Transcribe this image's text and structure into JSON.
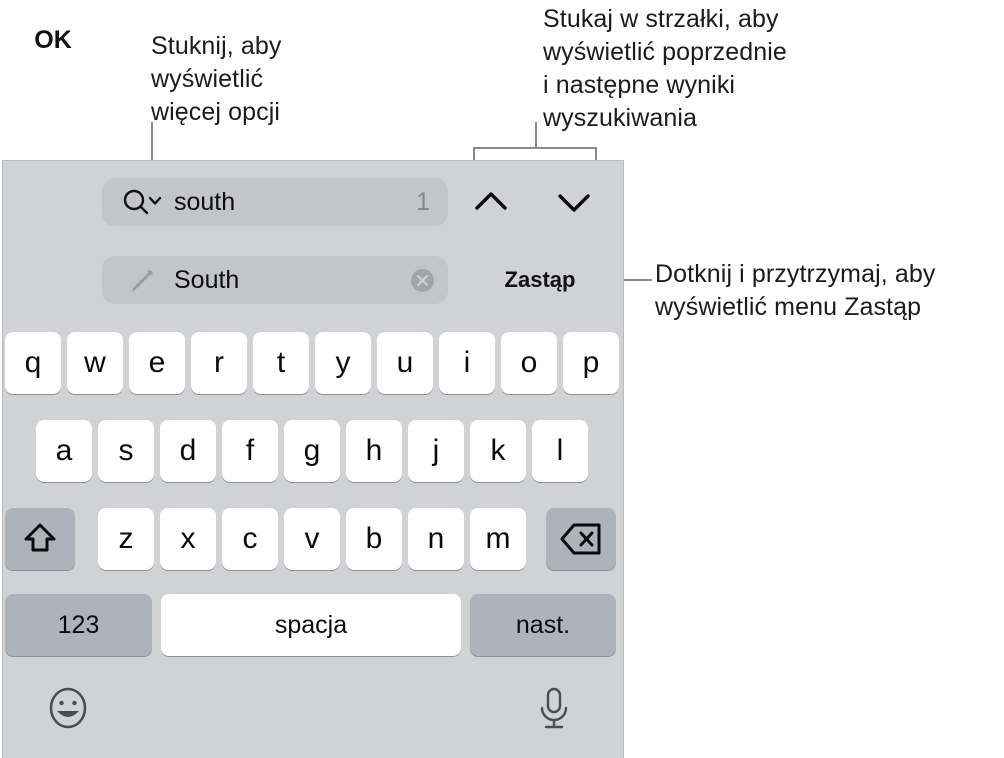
{
  "annotations": {
    "left": "Stuknij, aby\nwyświetlić\nwięcej opcji",
    "top_right": "Stukaj w strzałki, aby\nwyświetlić poprzednie\ni następne wyniki\nwyszukiwania",
    "right": "Dotknij i przytrzymaj, aby\nwyświetlić menu Zastąp"
  },
  "toolbar": {
    "ok_label": "OK",
    "search": {
      "value": "south",
      "match_count": "1",
      "icon": "search-icon",
      "disclosure_icon": "chevron-down-icon"
    },
    "replace": {
      "value": "South",
      "icon": "pencil-icon",
      "clear_icon": "clear-circle-icon"
    },
    "prev_icon": "chevron-up-icon",
    "next_icon": "chevron-down-icon",
    "replace_label": "Zastąp"
  },
  "keyboard": {
    "row1": [
      "q",
      "w",
      "e",
      "r",
      "t",
      "y",
      "u",
      "i",
      "o",
      "p"
    ],
    "row2": [
      "a",
      "s",
      "d",
      "f",
      "g",
      "h",
      "j",
      "k",
      "l"
    ],
    "row3": [
      "z",
      "x",
      "c",
      "v",
      "b",
      "n",
      "m"
    ],
    "shift_icon": "shift-arrow-icon",
    "backspace_icon": "delete-left-icon",
    "numeric_label": "123",
    "space_label": "spacja",
    "next_label": "nast.",
    "emoji_icon": "smiley-face-icon",
    "mic_icon": "microphone-icon"
  },
  "colors": {
    "panel_background": "#d0d2d6",
    "key_white": "#ffffff",
    "key_grey": "#aeb3bb",
    "field_background": "#c3c5ca",
    "text": "#0b0b0b",
    "leader_line": "#8a8a8d"
  }
}
